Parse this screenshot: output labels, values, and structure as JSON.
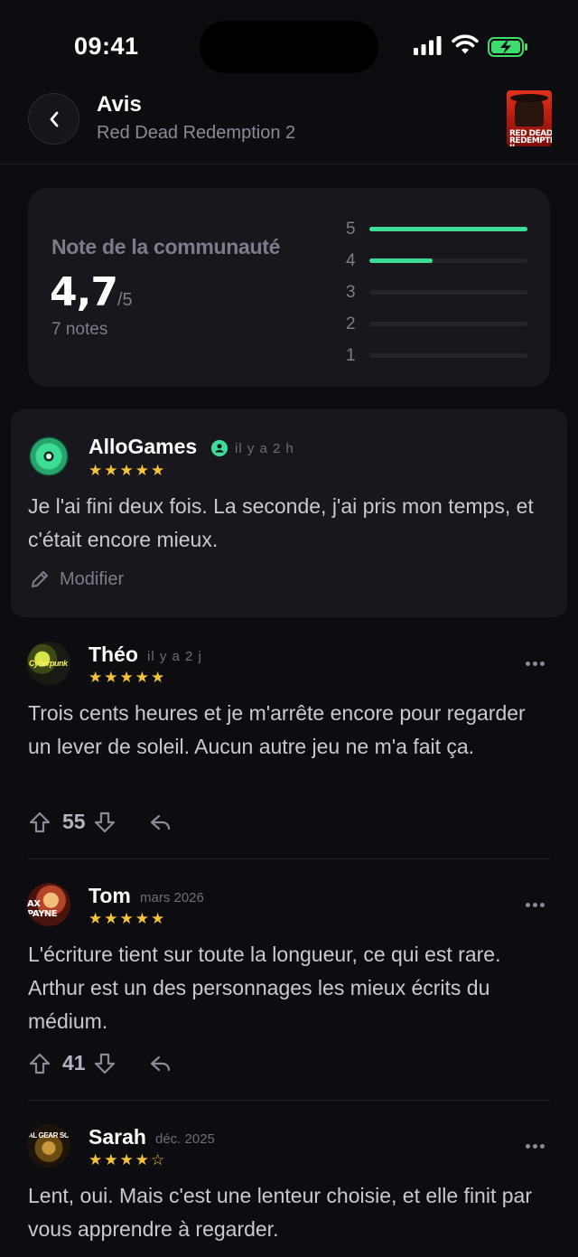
{
  "status": {
    "time": "09:41"
  },
  "header": {
    "title": "Avis",
    "subtitle": "Red Dead Redemption 2",
    "cover_text": "RED DEAD REDEMPTION II"
  },
  "rating": {
    "title": "Note de la communauté",
    "score": "4,7",
    "max": "/5",
    "count": "7 notes",
    "distribution": [
      {
        "stars": "5",
        "fraction": 1.0
      },
      {
        "stars": "4",
        "fraction": 0.4
      },
      {
        "stars": "3",
        "fraction": 0
      },
      {
        "stars": "2",
        "fraction": 0
      },
      {
        "stars": "1",
        "fraction": 0
      }
    ]
  },
  "own_review": {
    "author": "AlloGames",
    "time": "il y a 2 h",
    "stars": "★★★★★",
    "text": "Je l'ai fini deux fois. La seconde, j'ai pris mon temps, et c'était encore mieux.",
    "edit_label": "Modifier"
  },
  "reviews": [
    {
      "author": "Théo",
      "time": "il y a 2 j",
      "stars": "★★★★★",
      "text": "Trois cents heures et je m'arrête encore pour regarder un lever de soleil. Aucun autre jeu ne m'a fait ça.",
      "votes": "55",
      "avatar_text": "Cyberpunk"
    },
    {
      "author": "Tom",
      "time": "mars 2026",
      "stars": "★★★★★",
      "text": "L'écriture tient sur toute la longueur, ce qui est rare. Arthur est un des personnages les mieux écrits du médium.",
      "votes": "41",
      "avatar_text": "AX PAYNE"
    },
    {
      "author": "Sarah",
      "time": "déc. 2025",
      "stars": "★★★★☆",
      "text": "Lent, oui. Mais c'est une lenteur choisie, et elle finit par vous apprendre à regarder.",
      "avatar_text": "AL GEAR SO"
    }
  ],
  "colors": {
    "background": "#0c0c11",
    "card": "#17171d",
    "accent": "#3ddc97",
    "star": "#f5c33b",
    "battery": "#3ddc6d"
  }
}
